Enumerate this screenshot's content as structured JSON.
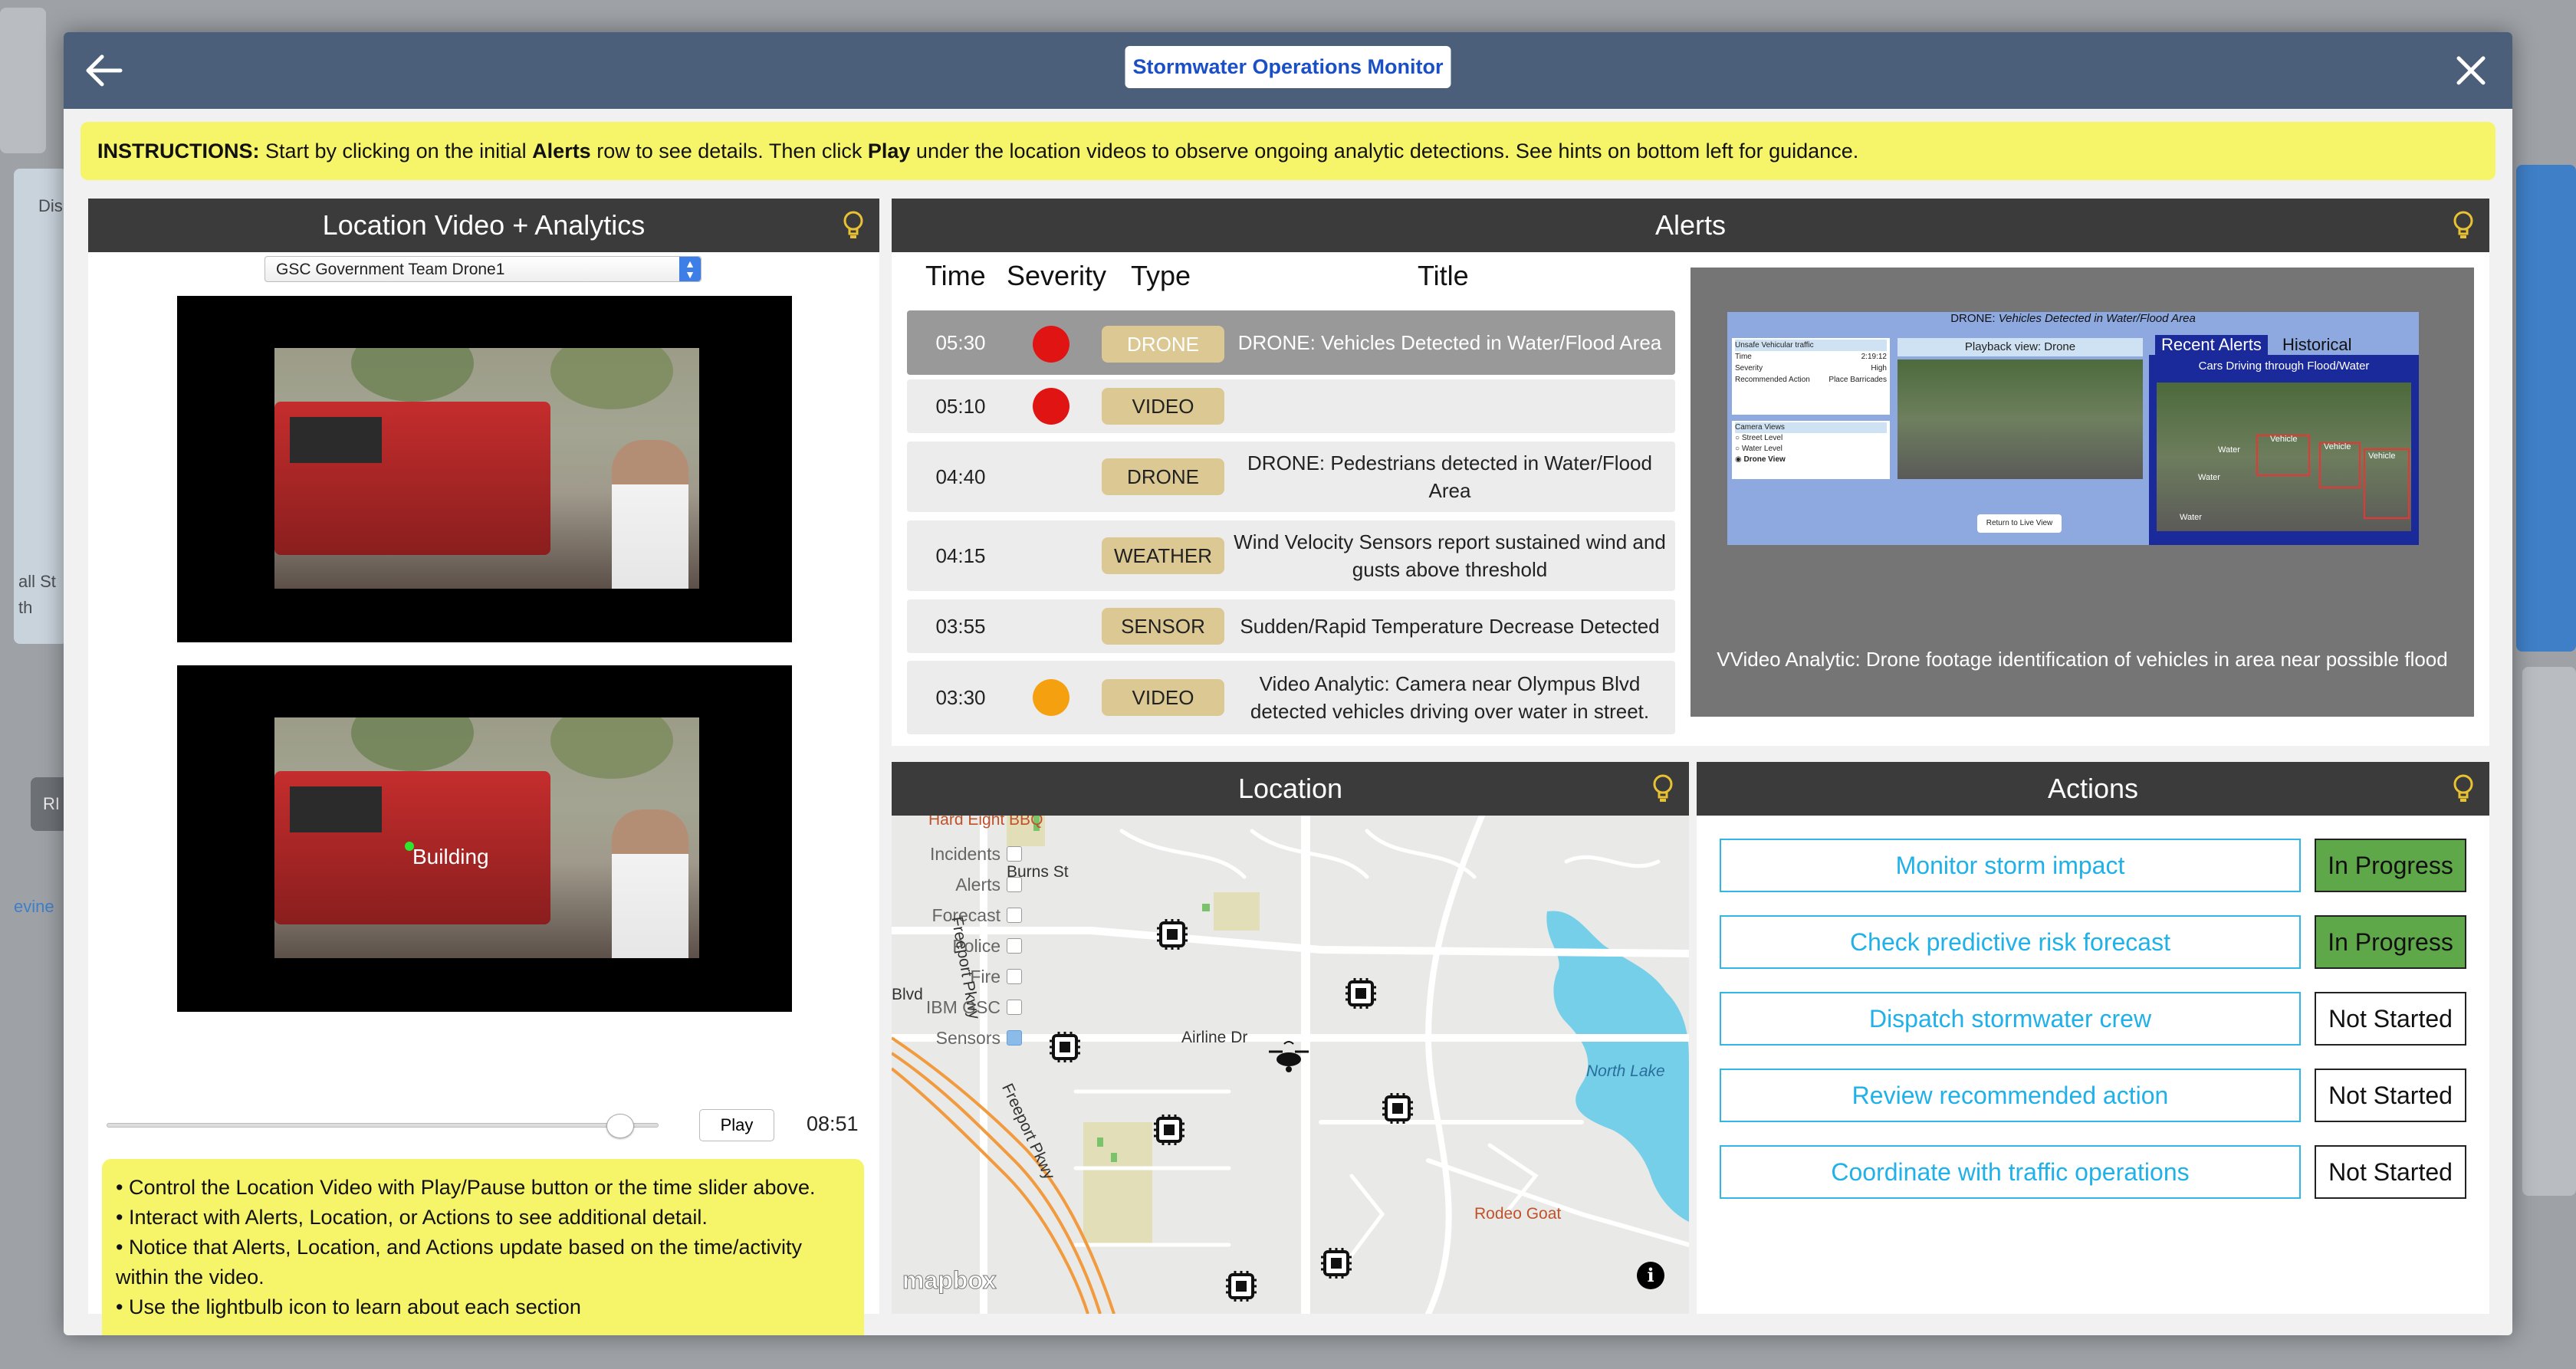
{
  "modal": {
    "title": "Stormwater Operations Monitor"
  },
  "instructions": {
    "lead": "INSTRUCTIONS:",
    "t1": " Start by clicking on the initial ",
    "b1": "Alerts",
    "t2": " row to see details. Then click ",
    "b2": "Play",
    "t3": " under the location videos to observe ongoing analytic detections. See hints on bottom left for guidance."
  },
  "video_panel": {
    "title": "Location Video + Analytics",
    "source_selected": "GSC Government Team Drone1",
    "detection_label": "Building",
    "play_label": "Play",
    "time": "08:51",
    "progress": 0.93,
    "hints": [
      "• Control the Location Video with Play/Pause button or the time slider above.",
      "• Interact with Alerts, Location, or Actions to see additional detail.",
      "• Notice that Alerts, Location, and Actions update based on the time/activity within the video.",
      "• Use the lightbulb icon to learn about each section"
    ]
  },
  "alerts_panel": {
    "title": "Alerts",
    "columns": {
      "time": "Time",
      "severity": "Severity",
      "type": "Type",
      "title": "Title"
    },
    "rows": [
      {
        "time": "05:30",
        "severity_color": "#e11414",
        "type": "DRONE",
        "title": "DRONE: Vehicles Detected in Water/Flood Area"
      },
      {
        "time": "05:10",
        "severity_color": "#e11414",
        "type": "VIDEO",
        "title": ""
      },
      {
        "time": "04:40",
        "severity_color": "",
        "type": "DRONE",
        "title": "DRONE: Pedestrians detected in Water/Flood Area"
      },
      {
        "time": "04:15",
        "severity_color": "",
        "type": "WEATHER",
        "title": "Wind Velocity Sensors report sustained wind and gusts above threshold"
      },
      {
        "time": "03:55",
        "severity_color": "",
        "type": "SENSOR",
        "title": "Sudden/Rapid Temperature Decrease Detected"
      },
      {
        "time": "03:30",
        "severity_color": "#f5a00f",
        "type": "VIDEO",
        "title": "Video Analytic: Camera near Olympus Blvd detected vehicles driving over water in street."
      }
    ],
    "detail": {
      "caption": "VVideo Analytic: Drone footage identification of vehicles in area near possible flood",
      "shot_header_prefix": "DRONE:",
      "shot_header_title": "Vehicles Detected in Water/Flood Area",
      "info_heading": "Unsafe Vehicular traffic",
      "info_rows": [
        {
          "k": "Time",
          "v": "2:19:12"
        },
        {
          "k": "Severity",
          "v": "High"
        },
        {
          "k": "Recommended Action",
          "v": "Place Barricades"
        }
      ],
      "camera_views_heading": "Camera Views",
      "camera_views": [
        "Street Level",
        "Water Level",
        "Drone View"
      ],
      "playback_label": "Playback view:  Drone",
      "return_label": "Return to Live View",
      "recent_tab": "Recent Alerts",
      "historical_tab": "Historical",
      "recent_caption": "Cars Driving through Flood/Water",
      "box_label_vehicle": "Vehicle",
      "box_label_water": "Water"
    }
  },
  "location_panel": {
    "title": "Location",
    "legend": [
      {
        "label": "Incidents",
        "checked": false
      },
      {
        "label": "Alerts",
        "checked": false
      },
      {
        "label": "Forecast",
        "checked": false
      },
      {
        "label": "Police",
        "checked": false
      },
      {
        "label": "Fire",
        "checked": false
      },
      {
        "label": "IBM GSC",
        "checked": false
      },
      {
        "label": "Sensors",
        "checked": true
      }
    ],
    "labels": {
      "hard_eight": "Hard Eight BBQ",
      "burns": "Burns St",
      "airline": "Airline Dr",
      "freeport1": "Freeport Pkwy",
      "freeport2": "Freeport Pkwy",
      "north_lake": "North Lake",
      "rodeo": "Rodeo Goat",
      "blvd": "Blvd",
      "mapbox": "mapbox"
    }
  },
  "actions_panel": {
    "title": "Actions",
    "items": [
      {
        "label": "Monitor storm impact",
        "status": "In Progress"
      },
      {
        "label": "Check predictive risk forecast",
        "status": "In Progress"
      },
      {
        "label": "Dispatch stormwater crew",
        "status": "Not Started"
      },
      {
        "label": "Review recommended action",
        "status": "Not Started"
      },
      {
        "label": "Coordinate with traffic operations",
        "status": "Not Started"
      }
    ]
  },
  "background": {
    "t1": "Dis",
    "t2": "all St",
    "t3": "th",
    "t4": "RI",
    "t5": "evine"
  },
  "colors": {
    "header": "#4b5f7a",
    "panel_head": "#3b3b3b",
    "instructions_bg": "#f6f56a",
    "action_accent": "#1fb1e8",
    "in_progress": "#5fa84a",
    "severity_high": "#e11414",
    "severity_medium": "#f5a00f"
  }
}
